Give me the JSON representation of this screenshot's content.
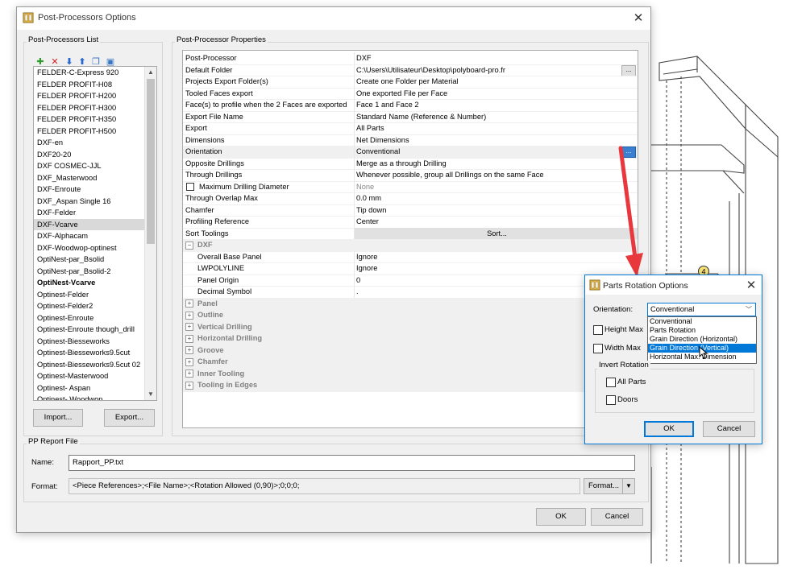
{
  "main_window": {
    "title": "Post-Processors Options",
    "list_group_label": "Post-Processors List",
    "list_items": [
      {
        "label": "FELDER-C-Express 920",
        "selected": false,
        "bold": false
      },
      {
        "label": "FELDER PROFIT-H08",
        "selected": false,
        "bold": false
      },
      {
        "label": "FELDER PROFIT-H200",
        "selected": false,
        "bold": false
      },
      {
        "label": "FELDER PROFIT-H300",
        "selected": false,
        "bold": false
      },
      {
        "label": "FELDER PROFIT-H350",
        "selected": false,
        "bold": false
      },
      {
        "label": "FELDER PROFIT-H500",
        "selected": false,
        "bold": false
      },
      {
        "label": "DXF-en",
        "selected": false,
        "bold": false
      },
      {
        "label": "DXF20-20",
        "selected": false,
        "bold": false
      },
      {
        "label": "DXF COSMEC-JJL",
        "selected": false,
        "bold": false
      },
      {
        "label": "DXF_Masterwood",
        "selected": false,
        "bold": false
      },
      {
        "label": "DXF-Enroute",
        "selected": false,
        "bold": false
      },
      {
        "label": "DXF_Aspan Single 16",
        "selected": false,
        "bold": false
      },
      {
        "label": "DXF-Felder",
        "selected": false,
        "bold": false
      },
      {
        "label": "DXF-Vcarve",
        "selected": true,
        "bold": false
      },
      {
        "label": "DXF-Alphacam",
        "selected": false,
        "bold": false
      },
      {
        "label": "DXF-Woodwop-optinest",
        "selected": false,
        "bold": false
      },
      {
        "label": "OptiNest-par_Bsolid",
        "selected": false,
        "bold": false
      },
      {
        "label": "OptiNest-par_Bsolid-2",
        "selected": false,
        "bold": false
      },
      {
        "label": "OptiNest-Vcarve",
        "selected": false,
        "bold": true
      },
      {
        "label": "Optinest-Felder",
        "selected": false,
        "bold": false
      },
      {
        "label": "Optinest-Felder2",
        "selected": false,
        "bold": false
      },
      {
        "label": "Optinest-Enroute",
        "selected": false,
        "bold": false
      },
      {
        "label": "Optinest-Enroute though_drill",
        "selected": false,
        "bold": false
      },
      {
        "label": "Optinest-Biesseworks",
        "selected": false,
        "bold": false
      },
      {
        "label": "Optinest-Biesseworks9.5cut",
        "selected": false,
        "bold": false
      },
      {
        "label": "Optinest-Biesseworks9.5cut 02",
        "selected": false,
        "bold": false
      },
      {
        "label": "Optinest-Masterwood",
        "selected": false,
        "bold": false
      },
      {
        "label": "Optinest- Aspan",
        "selected": false,
        "bold": false
      },
      {
        "label": "Optinest- Woodwop",
        "selected": false,
        "bold": false
      }
    ],
    "import_button": "Import...",
    "export_button": "Export...",
    "properties_group_label": "Post-Processor Properties",
    "properties": [
      {
        "name": "Post-Processor",
        "value": "DXF"
      },
      {
        "name": "Default Folder",
        "value": "C:\\Users\\Utilisateur\\Desktop\\polyboard-pro.fr",
        "button": "..."
      },
      {
        "name": "Projects Export Folder(s)",
        "value": "Create one Folder per Material"
      },
      {
        "name": "Tooled Faces export",
        "value": "One exported File per Face"
      },
      {
        "name": "Face(s) to profile when the 2 Faces are exported",
        "value": "Face 1 and Face 2"
      },
      {
        "name": "Export File Name",
        "value": "Standard Name (Reference & Number)"
      },
      {
        "name": "Export",
        "value": "All Parts"
      },
      {
        "name": "Dimensions",
        "value": "Net Dimensions"
      },
      {
        "name": "Orientation",
        "value": "Conventional",
        "highlight": true,
        "button": "..."
      },
      {
        "name": "Opposite Drillings",
        "value": "Merge as a through Drilling"
      },
      {
        "name": "Through Drillings",
        "value": "Whenever possible, group all Drillings on the same Face"
      },
      {
        "name": "Maximum Drilling Diameter",
        "value": "None",
        "checkbox": true,
        "gray": true
      },
      {
        "name": "Through Overlap Max",
        "value": "0.0 mm"
      },
      {
        "name": "Chamfer",
        "value": "Tip down"
      },
      {
        "name": "Profiling Reference",
        "value": "Center"
      },
      {
        "name": "Sort Toolings",
        "value": "Sort...",
        "sortbutton": true
      },
      {
        "name": "DXF",
        "value": "",
        "category": true,
        "expander": "−"
      },
      {
        "name": "Overall Base Panel",
        "value": "Ignore",
        "indent": true
      },
      {
        "name": "LWPOLYLINE",
        "value": "Ignore",
        "indent": true
      },
      {
        "name": "Panel Origin",
        "value": "0",
        "indent": true
      },
      {
        "name": "Decimal Symbol",
        "value": ".",
        "indent": true
      },
      {
        "name": "Panel",
        "value": "",
        "category": true,
        "expander": "+"
      },
      {
        "name": "Outline",
        "value": "",
        "category": true,
        "expander": "+"
      },
      {
        "name": "Vertical Drilling",
        "value": "",
        "category": true,
        "expander": "+"
      },
      {
        "name": "Horizontal Drilling",
        "value": "",
        "category": true,
        "expander": "+"
      },
      {
        "name": "Groove",
        "value": "",
        "category": true,
        "expander": "+"
      },
      {
        "name": "Chamfer",
        "value": "",
        "category": true,
        "expander": "+"
      },
      {
        "name": "Inner Tooling",
        "value": "",
        "category": true,
        "expander": "+"
      },
      {
        "name": "Tooling in Edges",
        "value": "",
        "category": true,
        "expander": "+"
      }
    ],
    "report_group_label": "PP Report File",
    "name_label": "Name:",
    "name_value": "Rapport_PP.txt",
    "format_label": "Format:",
    "format_value": "<Piece References>;<File Name>;<Rotation Allowed (0,90)>;0;0;0;",
    "format_button": "Format...",
    "ok_button": "OK",
    "cancel_button": "Cancel"
  },
  "rotation_dialog": {
    "title": "Parts Rotation Options",
    "orientation_label": "Orientation:",
    "orientation_value": "Conventional",
    "options": [
      "Conventional",
      "Parts Rotation",
      "Grain Direction (Horizontal)",
      "Grain Direction (Vertical)",
      "Horizontal Max. Dimension"
    ],
    "selected_option_index": 3,
    "height_max_label": "Height Max",
    "width_max_label": "Width Max",
    "invert_rotation_label": "Invert Rotation",
    "all_parts_label": "All Parts",
    "doors_label": "Doors",
    "ok_button": "OK",
    "cancel_button": "Cancel"
  },
  "background": {
    "callout_number": "4"
  },
  "colors": {
    "arrow": "#e8383d",
    "selection": "#0078d7",
    "callout_fill": "#f7e27a"
  }
}
